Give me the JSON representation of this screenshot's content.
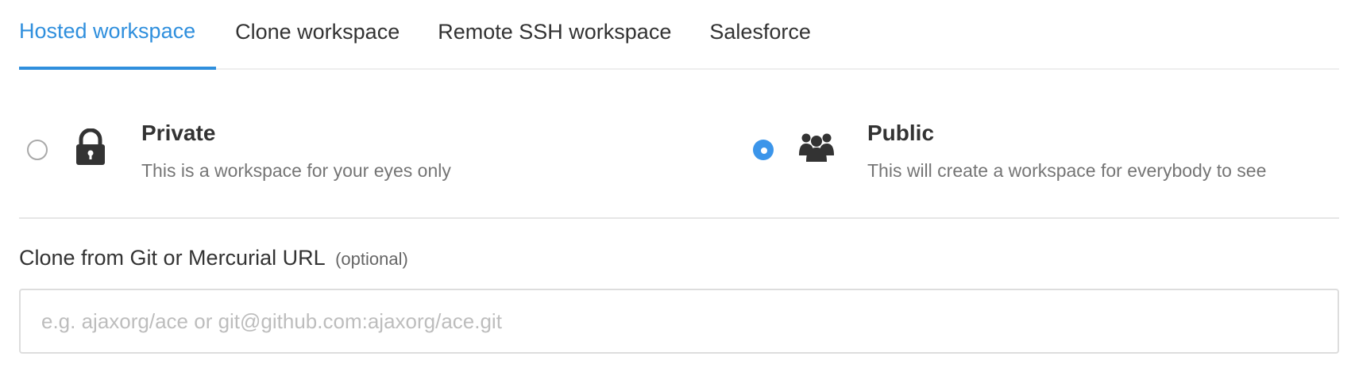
{
  "tabs": [
    {
      "label": "Hosted workspace",
      "active": true
    },
    {
      "label": "Clone workspace",
      "active": false
    },
    {
      "label": "Remote SSH workspace",
      "active": false
    },
    {
      "label": "Salesforce",
      "active": false
    }
  ],
  "visibility": {
    "private": {
      "title": "Private",
      "description": "This is a workspace for your eyes only",
      "icon": "lock-icon",
      "selected": false
    },
    "public": {
      "title": "Public",
      "description": "This will create a workspace for everybody to see",
      "icon": "users-icon",
      "selected": true
    }
  },
  "clone": {
    "label": "Clone from Git or Mercurial URL",
    "optional": "(optional)",
    "value": "",
    "placeholder": "e.g. ajaxorg/ace or git@github.com:ajaxorg/ace.git"
  },
  "colors": {
    "accent": "#2f8fdd",
    "radio_selected": "#3b95ea",
    "text": "#333333",
    "muted": "#757575"
  }
}
